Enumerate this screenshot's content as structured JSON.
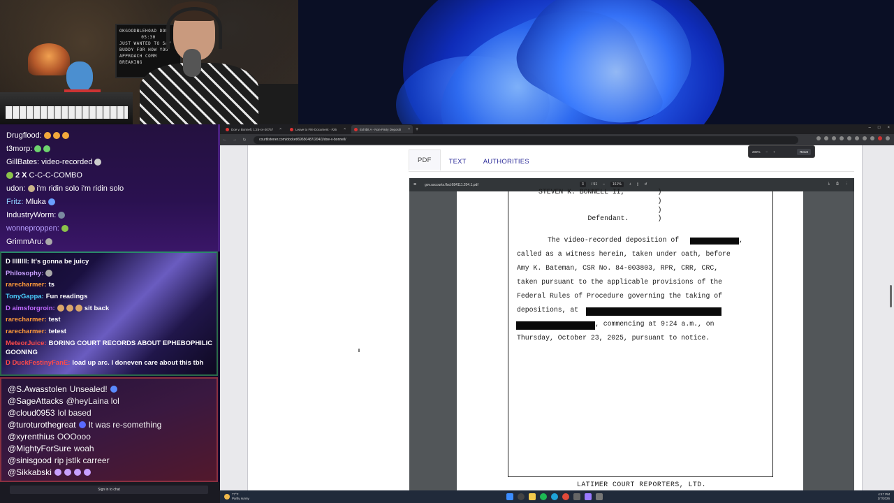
{
  "webcam": {
    "board_lines": [
      "OKGOODBLEHOAD DON",
      "05:30",
      "JUST WANTED TO SAY",
      "BUDDY FOR HOW YOU",
      "APPROACH COMM",
      "BREAKING"
    ]
  },
  "chat_top": [
    {
      "user": "Drugflood:",
      "text": "",
      "color": "#ffffff"
    },
    {
      "user": "t3morp:",
      "text": "",
      "color": "#ffffff"
    },
    {
      "user": "GillBates:",
      "text": "video-recorded",
      "color": "#ffffff"
    },
    {
      "user": "2 X",
      "text": "C-C-C-COMBO",
      "color": "#ffffff"
    },
    {
      "user": "udon:",
      "text": "i'm ridin solo i'm ridin solo",
      "color": "#ffffff"
    },
    {
      "user": "Fritz:",
      "text": "Mluka",
      "color": "#8fd0ff"
    },
    {
      "user": "IndustryWorm:",
      "text": "",
      "color": "#ffffff"
    },
    {
      "user": "wonneproppen:",
      "text": "",
      "color": "#b8a0ff"
    },
    {
      "user": "GrimmAru:",
      "text": "",
      "color": "#ffffff"
    }
  ],
  "chat_mid": [
    {
      "user": "D llllllll:",
      "text": "It's gonna be juicy",
      "color": "#ffffff"
    },
    {
      "user": "Philosophy:",
      "text": "",
      "color": "#c8a0ff"
    },
    {
      "user": "rarecharmer:",
      "text": "ts",
      "color": "#ff9a3a"
    },
    {
      "user": "TonyGappa:",
      "text": "Fun readings",
      "color": "#4ad0ff"
    },
    {
      "user": "D aimsforgroin:",
      "text": "sit back",
      "color": "#c06aff"
    },
    {
      "user": "rarecharmer:",
      "text": "test",
      "color": "#ff9a3a"
    },
    {
      "user": "rarecharmer:",
      "text": "tetest",
      "color": "#ff9a3a"
    },
    {
      "user": "MeteorJuice:",
      "text": "BORING COURT RECORDS ABOUT EPHEBOPHILIC GOONING",
      "color": "#ff4a4a"
    },
    {
      "user": "D DuckFestinyFanE:",
      "text": "load up arc. I doneven care about this tbh",
      "color": "#ff4a4a"
    }
  ],
  "chat_bottom": [
    {
      "user": "@S.Awasstolen",
      "text": "Unsealed!"
    },
    {
      "user": "@SageAttacks",
      "text": "@heyLaina lol"
    },
    {
      "user": "@cloud0953",
      "text": "lol based"
    },
    {
      "user": "@turoturothegreat",
      "text": "It was re-something"
    },
    {
      "user": "@xyrenthius",
      "text": "OOOooo"
    },
    {
      "user": "@MightyForSure",
      "text": "woah"
    },
    {
      "user": "@sinisgood",
      "text": "rip jstlk carreer"
    },
    {
      "user": "@Sikkabski",
      "text": ""
    }
  ],
  "chat_footer": {
    "signin": "Sign in to chat"
  },
  "browser": {
    "tabs": [
      {
        "label": "Doe v. Bonnell, 1:25-cv-20757",
        "active": false
      },
      {
        "label": "Leave to File Document - #26",
        "active": false
      },
      {
        "label": "Exhibit A - Non-Party Depositi",
        "active": true
      }
    ],
    "url": "courtlistener.com/docket/69650487/204/1/doe-v-bonnell/",
    "zoom": {
      "value": "200%",
      "minus": "–",
      "plus": "+",
      "reset": "Reset"
    }
  },
  "doc": {
    "tabs": [
      "PDF",
      "TEXT",
      "AUTHORITIES"
    ],
    "active_tab": "PDF",
    "pdf_filename": "gov.uscourts.flsd.684111.204.1.pdf",
    "page_indicator": "3",
    "page_total": "/ 51",
    "zoom_percent": "161%",
    "lines": [
      "STEVEN K. BONNELL II,        )",
      "                             )",
      "                             )",
      "            Defendant.       )"
    ],
    "para": {
      "l1": "The video-recorded deposition of",
      "l1_end": ",",
      "l2": "called as a witness herein, taken under oath, before",
      "l3": "Amy K. Bateman, CSR No. 84-003803, RPR, CRR, CRC,",
      "l4": "taken pursuant to the applicable provisions of the",
      "l5": "Federal Rules of Procedure governing the taking of",
      "l6": "depositions, at",
      "l7_end": ", commencing at 9:24 a.m., on",
      "l8": "Thursday, October 23, 2025, pursuant to notice."
    },
    "footer": "LATIMER COURT REPORTERS, LTD."
  },
  "taskbar": {
    "weather_temp": "77°F",
    "weather_desc": "Partly sunny",
    "time": "4:47 PM",
    "date": "1/7/2026"
  }
}
